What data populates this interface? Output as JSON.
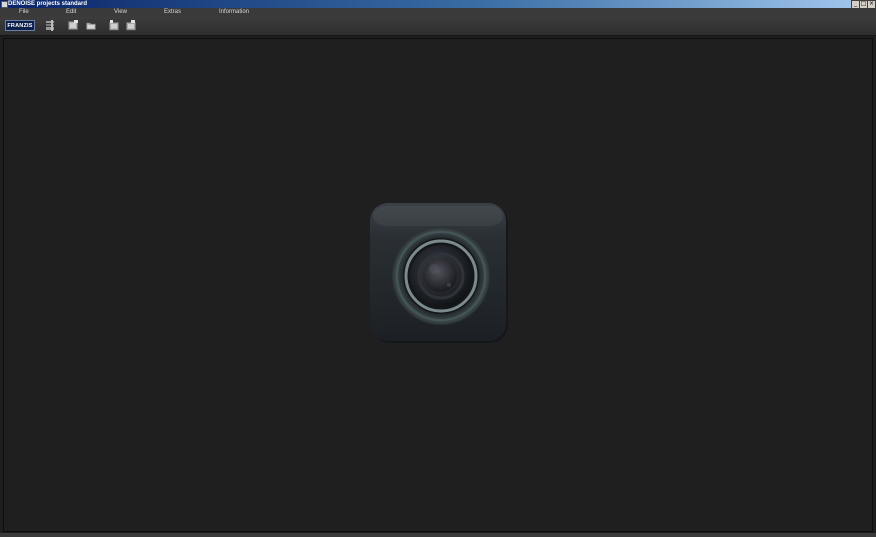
{
  "window": {
    "title": "DENOISE projects standard",
    "controls": [
      "_",
      "□",
      "×"
    ]
  },
  "menu": {
    "items": [
      "File",
      "Edit",
      "View",
      "Extras",
      "Information"
    ]
  },
  "toolbar": {
    "brand_label": "FRANZIS",
    "buttons": [
      "settings-icon",
      "open-image-icon",
      "open-folder-icon",
      "export-icon",
      "export-batch-icon"
    ]
  },
  "workspace": {
    "splash_icon": "camera-lens-icon"
  }
}
